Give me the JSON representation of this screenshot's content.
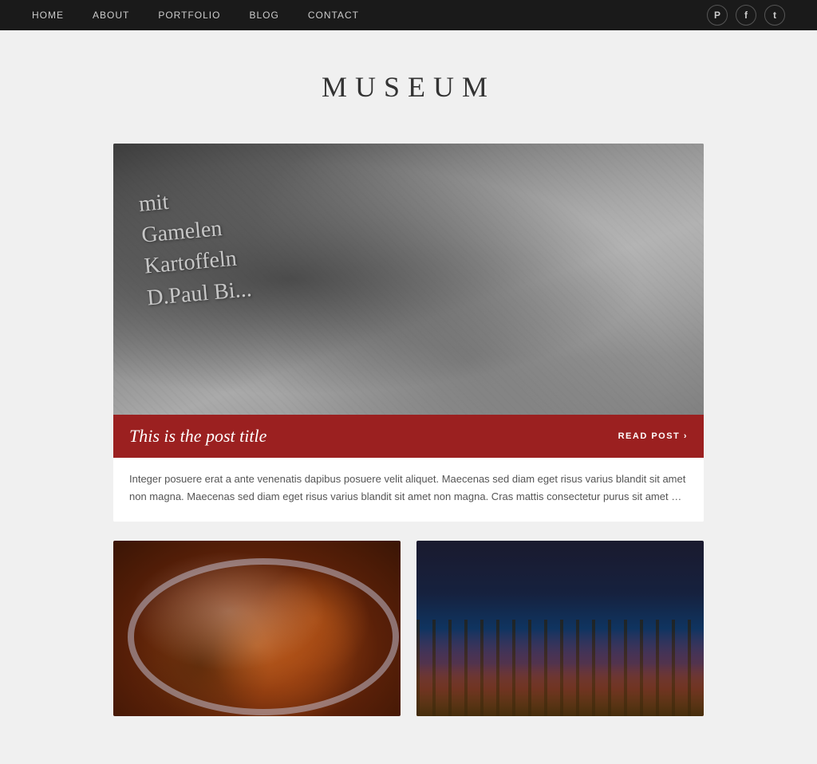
{
  "nav": {
    "links": [
      {
        "id": "home",
        "label": "HOME"
      },
      {
        "id": "about",
        "label": "ABOUT"
      },
      {
        "id": "portfolio",
        "label": "PORTFOLIO"
      },
      {
        "id": "blog",
        "label": "BLOG"
      },
      {
        "id": "contact",
        "label": "CONTACT"
      }
    ],
    "social": [
      {
        "id": "pinterest",
        "icon": "P",
        "label": "Pinterest"
      },
      {
        "id": "facebook",
        "icon": "f",
        "label": "Facebook"
      },
      {
        "id": "twitter",
        "icon": "t",
        "label": "Twitter"
      }
    ]
  },
  "site": {
    "title": "MUSEUM"
  },
  "featured_post": {
    "title": "This is the post title",
    "read_more": "READ POST ›",
    "excerpt": "Integer posuere erat a ante venenatis dapibus posuere velit aliquet. Maecenas sed diam eget risus varius blandit sit amet non magna. Maecenas sed diam eget risus varius blandit sit amet non magna. Cras mattis consectetur purus sit amet …",
    "cafe_lines": [
      "mit",
      "Gamelen",
      "Kartoffeln",
      "D.Paul Bi..."
    ]
  },
  "grid_posts": [
    {
      "id": "food-post",
      "type": "food",
      "alt": "Food dish on a plate"
    },
    {
      "id": "rome-post",
      "type": "rome",
      "alt": "Rome architecture at night"
    }
  ]
}
